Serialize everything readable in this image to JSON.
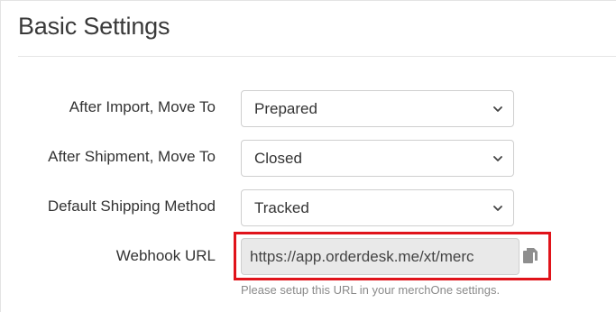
{
  "section": {
    "title": "Basic Settings"
  },
  "fields": [
    {
      "label": "After Import, Move To",
      "value": "Prepared"
    },
    {
      "label": "After Shipment, Move To",
      "value": "Closed"
    },
    {
      "label": "Default Shipping Method",
      "value": "Tracked"
    }
  ],
  "webhook": {
    "label": "Webhook URL",
    "value": "https://app.orderdesk.me/xt/merc",
    "help": "Please setup this URL in your merchOne settings.",
    "copy_icon": "copy-icon",
    "highlight_color": "#e0131a"
  }
}
